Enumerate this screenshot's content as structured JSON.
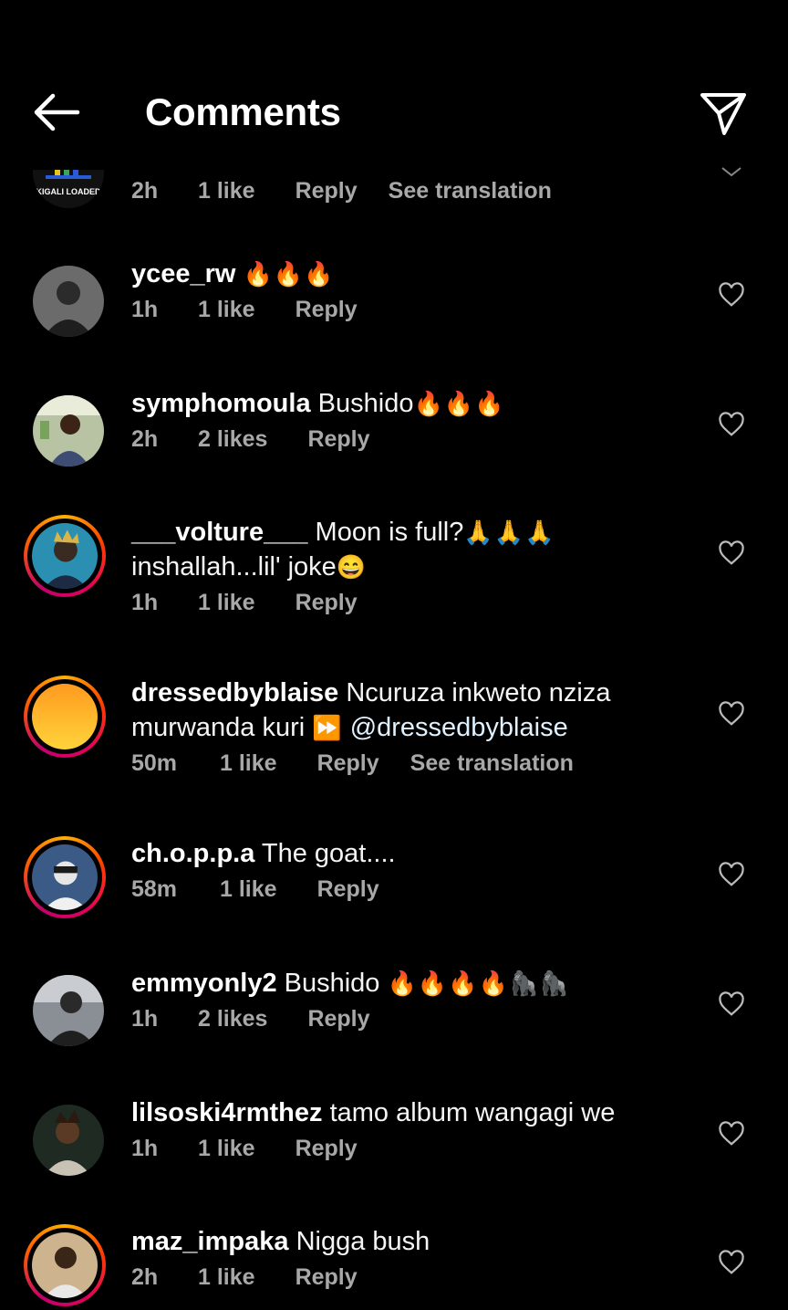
{
  "header": {
    "title": "Comments",
    "back_icon": "back-arrow-icon",
    "send_icon": "send-icon"
  },
  "partial_comment": {
    "avatar_text": "KIGALI LOADED",
    "time": "2h",
    "likes": "1 like",
    "reply": "Reply",
    "translate": "See translation"
  },
  "comments": [
    {
      "user": "ycee_rw",
      "text": "",
      "emoji": "🔥🔥🔥",
      "time": "1h",
      "likes": "1 like",
      "reply": "Reply"
    },
    {
      "user": "symphomoula",
      "text": "Bushido",
      "emoji": "🔥🔥🔥",
      "time": "2h",
      "likes": "2 likes",
      "reply": "Reply"
    },
    {
      "user": "___volture___",
      "text": "Moon is full?",
      "emoji": "🙏🙏🙏",
      "line2": "inshallah...lil' joke",
      "line2_emoji": "😄",
      "time": "1h",
      "likes": "1 like",
      "reply": "Reply"
    },
    {
      "user": "dressedbyblaise",
      "text": "Ncuruza inkweto nziza",
      "line2": "murwanda kuri",
      "line2_emoji": "⏩",
      "mention": "@dressedbyblaise",
      "time": "50m",
      "likes": "1 like",
      "reply": "Reply",
      "translate": "See translation"
    },
    {
      "user": "ch.o.p.p.a",
      "text": "The goat....",
      "time": "58m",
      "likes": "1 like",
      "reply": "Reply"
    },
    {
      "user": "emmyonly2",
      "text": "Bushido",
      "emoji": "🔥🔥🔥🔥🦍🦍",
      "time": "1h",
      "likes": "2 likes",
      "reply": "Reply"
    },
    {
      "user": "lilsoski4rmthez",
      "text": "tamo album wangagi we",
      "time": "1h",
      "likes": "1 like",
      "reply": "Reply"
    },
    {
      "user": "maz_impaka",
      "text": "Nigga bush",
      "time": "2h",
      "likes": "1 like",
      "reply": "Reply"
    }
  ],
  "colors": {
    "background": "#000000",
    "meta_text": "#a8a8a8",
    "mention": "#e0f1ff",
    "story_ring": "#ff3d00"
  }
}
